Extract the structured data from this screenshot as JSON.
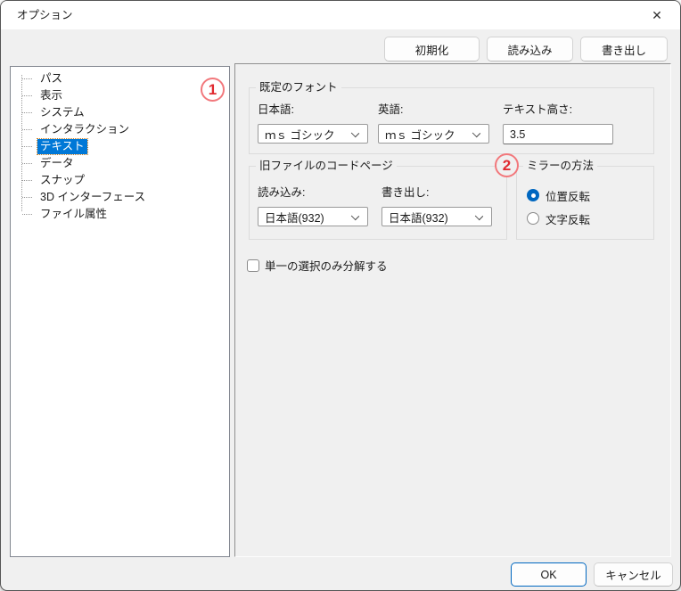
{
  "window": {
    "title": "オプション"
  },
  "titlebar": {
    "close_glyph": "✕"
  },
  "toolbar": {
    "initialize": "初期化",
    "load": "読み込み",
    "export": "書き出し"
  },
  "annotations": {
    "circle1": "1",
    "circle2": "2"
  },
  "sidebar": {
    "selected": "テキスト",
    "items": [
      {
        "label": "パス"
      },
      {
        "label": "表示"
      },
      {
        "label": "システム"
      },
      {
        "label": "インタラクション"
      },
      {
        "label": "テキスト"
      },
      {
        "label": "データ"
      },
      {
        "label": "スナップ"
      },
      {
        "label": "3D インターフェース"
      },
      {
        "label": "ファイル属性"
      }
    ]
  },
  "font_group": {
    "title": "既定のフォント",
    "japanese_label": "日本語:",
    "japanese_value": "ｍｓ ゴシック",
    "english_label": "英語:",
    "english_value": "ｍｓ ゴシック",
    "text_height_label": "テキスト高さ:",
    "text_height_value": "3.5"
  },
  "codepage_group": {
    "title": "旧ファイルのコードページ",
    "load_label": "読み込み:",
    "load_value": "日本語(932)",
    "export_label": "書き出し:",
    "export_value": "日本語(932)"
  },
  "mirror_group": {
    "title": "ミラーの方法",
    "option1": {
      "label": "位置反転",
      "selected": true
    },
    "option2": {
      "label": "文字反転",
      "selected": false
    }
  },
  "decompose_checkbox": {
    "label": "単一の選択のみ分解する",
    "checked": false
  },
  "footer": {
    "ok": "OK",
    "cancel": "キャンセル"
  },
  "colors": {
    "accent_blue": "#0067c0",
    "selection_blue": "#0078d7",
    "annotation_red": "#e02a30",
    "dialog_bg": "#f0f0f0"
  }
}
